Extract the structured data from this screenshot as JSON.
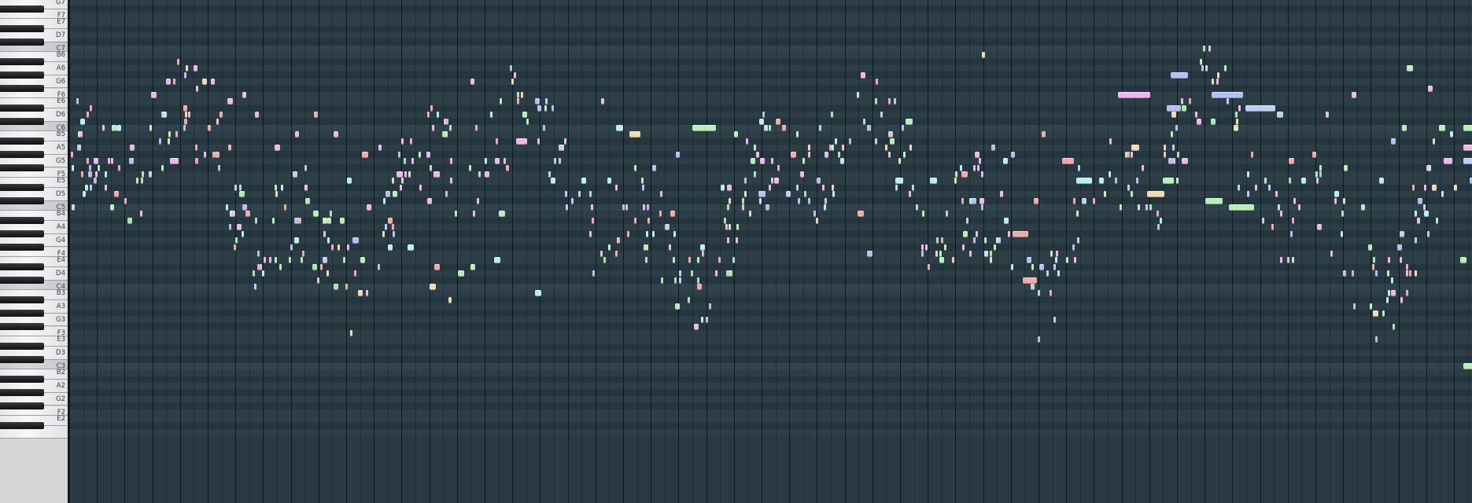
{
  "app": {
    "view": "Piano roll",
    "colors": {
      "grid_white_row": "#2d3e46",
      "grid_black_row": "#263640",
      "grid_c_row": "#31444d",
      "bar_line": "#0f1a1f",
      "keyboard_white": "#f2f3f4",
      "keyboard_black": "#1d1f21"
    },
    "channel_colors": [
      "#f2a9a9",
      "#f0b6f0",
      "#b6bff0",
      "#b6f0f0",
      "#b6f0b6",
      "#f0dcb0",
      "#f2b8e2",
      "#bcd0f2",
      "#a8e8b0"
    ]
  },
  "keyboard": {
    "labels": [
      "G7",
      "F7",
      "E7",
      "D7",
      "C7",
      "B6",
      "A6",
      "G6",
      "F6",
      "E6",
      "D6",
      "C6",
      "B5",
      "A5",
      "G5",
      "F5",
      "E5",
      "D5",
      "C5",
      "B4",
      "A4",
      "G4",
      "F4",
      "E4",
      "D4",
      "C4",
      "B3",
      "A3",
      "G3",
      "F3",
      "E3",
      "D3",
      "C3",
      "B2",
      "A2",
      "G2",
      "F2",
      "E2"
    ]
  }
}
